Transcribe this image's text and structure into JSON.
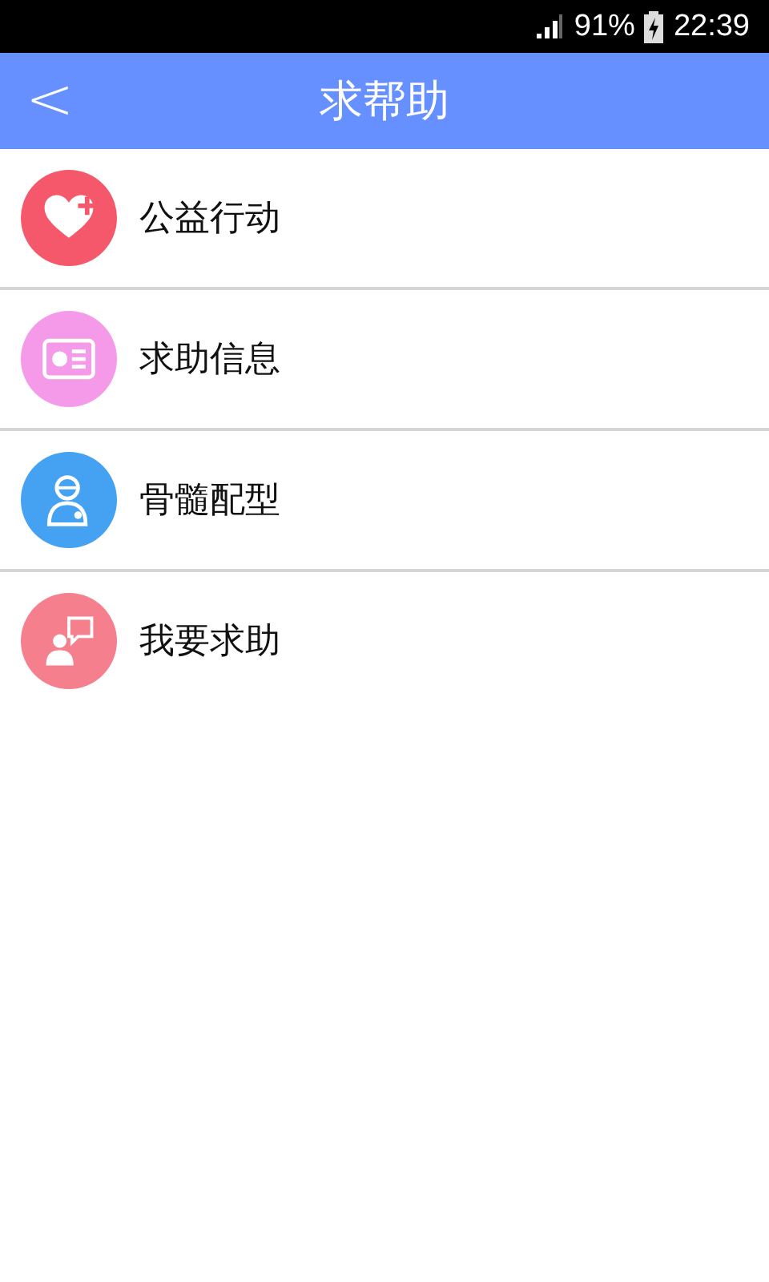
{
  "status_bar": {
    "battery_percent": "91%",
    "time": "22:39"
  },
  "header": {
    "back": "<",
    "title": "求帮助"
  },
  "items": [
    {
      "label": "公益行动",
      "kind": "heart",
      "color": "#f5586a"
    },
    {
      "label": "求助信息",
      "kind": "card",
      "color": "#f49ae9"
    },
    {
      "label": "骨髓配型",
      "kind": "doctor",
      "color": "#45a1f2"
    },
    {
      "label": "我要求助",
      "kind": "speaker",
      "color": "#f57f8c"
    }
  ]
}
